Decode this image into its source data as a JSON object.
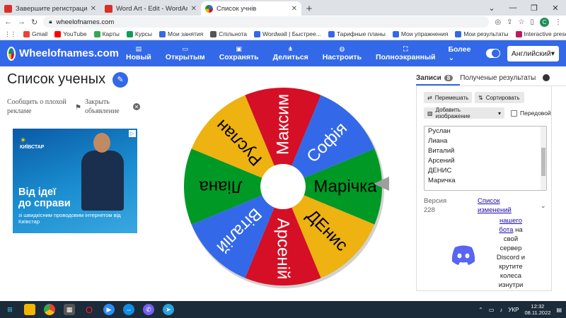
{
  "browser": {
    "tabs": [
      {
        "label": "Завершите регистрацию - Wo...",
        "color": "#d93025",
        "active": false
      },
      {
        "label": "Word Art - Edit - WordArt.com",
        "color": "#d93025",
        "active": false
      },
      {
        "label": "Список учнів",
        "color": "#4285f4",
        "active": true
      }
    ],
    "url": "wheelofnames.com",
    "profile_initial": "C",
    "bookmarks": [
      {
        "label": "Gmail",
        "color": "#ea4335"
      },
      {
        "label": "YouTube",
        "color": "#ff0000"
      },
      {
        "label": "Карты",
        "color": "#34a853"
      },
      {
        "label": "Курсы",
        "color": "#0f9d58"
      },
      {
        "label": "Мои занятия",
        "color": "#3369e8"
      },
      {
        "label": "Спільнота",
        "color": "#555555"
      },
      {
        "label": "Wordwall | Быстрее...",
        "color": "#3369e8"
      },
      {
        "label": "Тарифные планы",
        "color": "#3369e8"
      },
      {
        "label": "Мои упражнения",
        "color": "#3369e8"
      },
      {
        "label": "Мои результаты",
        "color": "#3369e8"
      },
      {
        "label": "Interactive presenta...",
        "color": "#c2185b"
      }
    ]
  },
  "header": {
    "logo": "Wheelofnames.com",
    "nav": [
      {
        "label": "Новый",
        "icon": "▤"
      },
      {
        "label": "Открытым",
        "icon": "▭"
      },
      {
        "label": "Сохранять",
        "icon": "▣"
      },
      {
        "label": "Делиться",
        "icon": "⋔"
      },
      {
        "label": "Настроить",
        "icon": "◍"
      },
      {
        "label": "Полноэкранный",
        "icon": "⛶"
      }
    ],
    "more": "Более",
    "language": "Английский"
  },
  "left": {
    "title": "Список ученых",
    "report_ad": "Сообщить о плохой рекламе",
    "close_ad": "Закрыть объявление"
  },
  "ad": {
    "brand": "КИЇВСТАР",
    "headline_1": "Від ідеї",
    "headline_2": "до справи",
    "sub": "зі швидкісним проводовим інтернетом від Київстар"
  },
  "wheel": {
    "segments": [
      {
        "name": "Марічка",
        "color": "#009925",
        "text_color": "#000000"
      },
      {
        "name": "ДЕнис",
        "color": "#eeb211",
        "text_color": "#000000"
      },
      {
        "name": "Арсеній",
        "color": "#d50f25",
        "text_color": "#ffffff"
      },
      {
        "name": "Віталій",
        "color": "#3369e8",
        "text_color": "#ffffff"
      },
      {
        "name": "Ліана",
        "color": "#009925",
        "text_color": "#000000"
      },
      {
        "name": "Руслан",
        "color": "#eeb211",
        "text_color": "#000000"
      },
      {
        "name": "Максим",
        "color": "#d50f25",
        "text_color": "#ffffff"
      },
      {
        "name": "Софія",
        "color": "#3369e8",
        "text_color": "#ffffff"
      }
    ]
  },
  "panel": {
    "tab_entries": "Записи",
    "entries_count": "8",
    "tab_results": "Полученые результаты",
    "shuffle": "Перемешать",
    "sort": "Сортировать",
    "add_image": "Добавить изображение",
    "foreground": "Передовой",
    "entries": [
      "Руслан",
      "Лиана",
      "Виталий",
      "Арсений",
      "ДЕНИС",
      "Маричка"
    ],
    "version_label": "Версия",
    "version_number": "228",
    "changelog_1": "Список",
    "changelog_2": "изменений",
    "discord_1": "нашего",
    "discord_2": "бота",
    "discord_3": "на",
    "discord_4": "свой",
    "discord_5": "сервер",
    "discord_6": "Discord и",
    "discord_7": "крутите",
    "discord_8": "колеса",
    "discord_9": "изнутри"
  },
  "taskbar": {
    "lang": "УКР",
    "time": "12:32",
    "date": "08.11.2022"
  }
}
